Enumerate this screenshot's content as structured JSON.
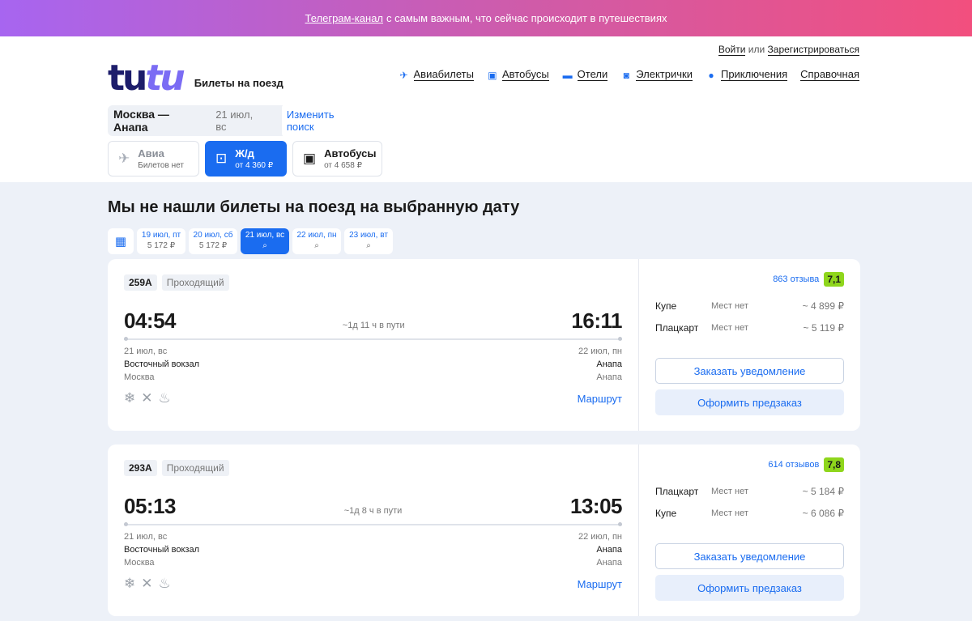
{
  "promo": {
    "link": "Телеграм-канал",
    "text": "с самым важным, что сейчас происходит в путешествиях"
  },
  "auth": {
    "login": "Войти",
    "or": "или",
    "register": "Зарегистрироваться"
  },
  "logo": {
    "part1": "tu",
    "part2": "tu",
    "subtitle": "Билеты на поезд"
  },
  "nav": [
    {
      "label": "Авиабилеты",
      "icon": "plane-icon"
    },
    {
      "label": "Автобусы",
      "icon": "bus-icon"
    },
    {
      "label": "Отели",
      "icon": "bed-icon"
    },
    {
      "label": "Электрички",
      "icon": "suburban-train-icon"
    },
    {
      "label": "Приключения",
      "icon": "balloon-icon"
    },
    {
      "label": "Справочная",
      "icon": ""
    }
  ],
  "search": {
    "route": "Москва — Анапа",
    "date": "21 июл, вс",
    "change": "Изменить поиск"
  },
  "modes": [
    {
      "title": "Авиа",
      "sub": "Билетов нет",
      "icon": "plane-icon"
    },
    {
      "title": "Ж/д",
      "sub": "от 4 360 ₽",
      "icon": "train-icon"
    },
    {
      "title": "Автобусы",
      "sub": "от 4 658 ₽",
      "icon": "bus-icon"
    }
  ],
  "title": "Мы не нашли билеты на поезд на выбранную дату",
  "dates": [
    {
      "label": "19 июл, пт",
      "sub": "5 172 ₽"
    },
    {
      "label": "20 июл, сб",
      "sub": "5 172 ₽"
    },
    {
      "label": "21 июл, вс",
      "sub": "⌕"
    },
    {
      "label": "22 июл, пн",
      "sub": "⌕"
    },
    {
      "label": "23 июл, вт",
      "sub": "⌕"
    }
  ],
  "trains": [
    {
      "number": "259А",
      "type": "Проходящий",
      "dep_time": "04:54",
      "arr_time": "16:11",
      "duration": "~1д 11 ч в пути",
      "dep_date": "21 июл, вс",
      "dep_station": "Восточный вокзал",
      "dep_city": "Москва",
      "arr_date": "22 июл, пн",
      "arr_station": "Анапа",
      "arr_city": "Анапа",
      "route_link": "Маршрут",
      "reviews": "863 отзыва",
      "rating": "7,1",
      "prices": [
        {
          "class": "Купе",
          "seats": "Мест нет",
          "price": "~ 4 899 ₽"
        },
        {
          "class": "Плацкарт",
          "seats": "Мест нет",
          "price": "~ 5 119 ₽"
        }
      ],
      "notify": "Заказать уведомление",
      "preorder": "Оформить предзаказ"
    },
    {
      "number": "293А",
      "type": "Проходящий",
      "dep_time": "05:13",
      "arr_time": "13:05",
      "duration": "~1д 8 ч в пути",
      "dep_date": "21 июл, вс",
      "dep_station": "Восточный вокзал",
      "dep_city": "Москва",
      "arr_date": "22 июл, пн",
      "arr_station": "Анапа",
      "arr_city": "Анапа",
      "route_link": "Маршрут",
      "reviews": "614 отзывов",
      "rating": "7,8",
      "prices": [
        {
          "class": "Плацкарт",
          "seats": "Мест нет",
          "price": "~ 5 184 ₽"
        },
        {
          "class": "Купе",
          "seats": "Мест нет",
          "price": "~ 6 086 ₽"
        }
      ],
      "notify": "Заказать уведомление",
      "preorder": "Оформить предзаказ"
    }
  ]
}
